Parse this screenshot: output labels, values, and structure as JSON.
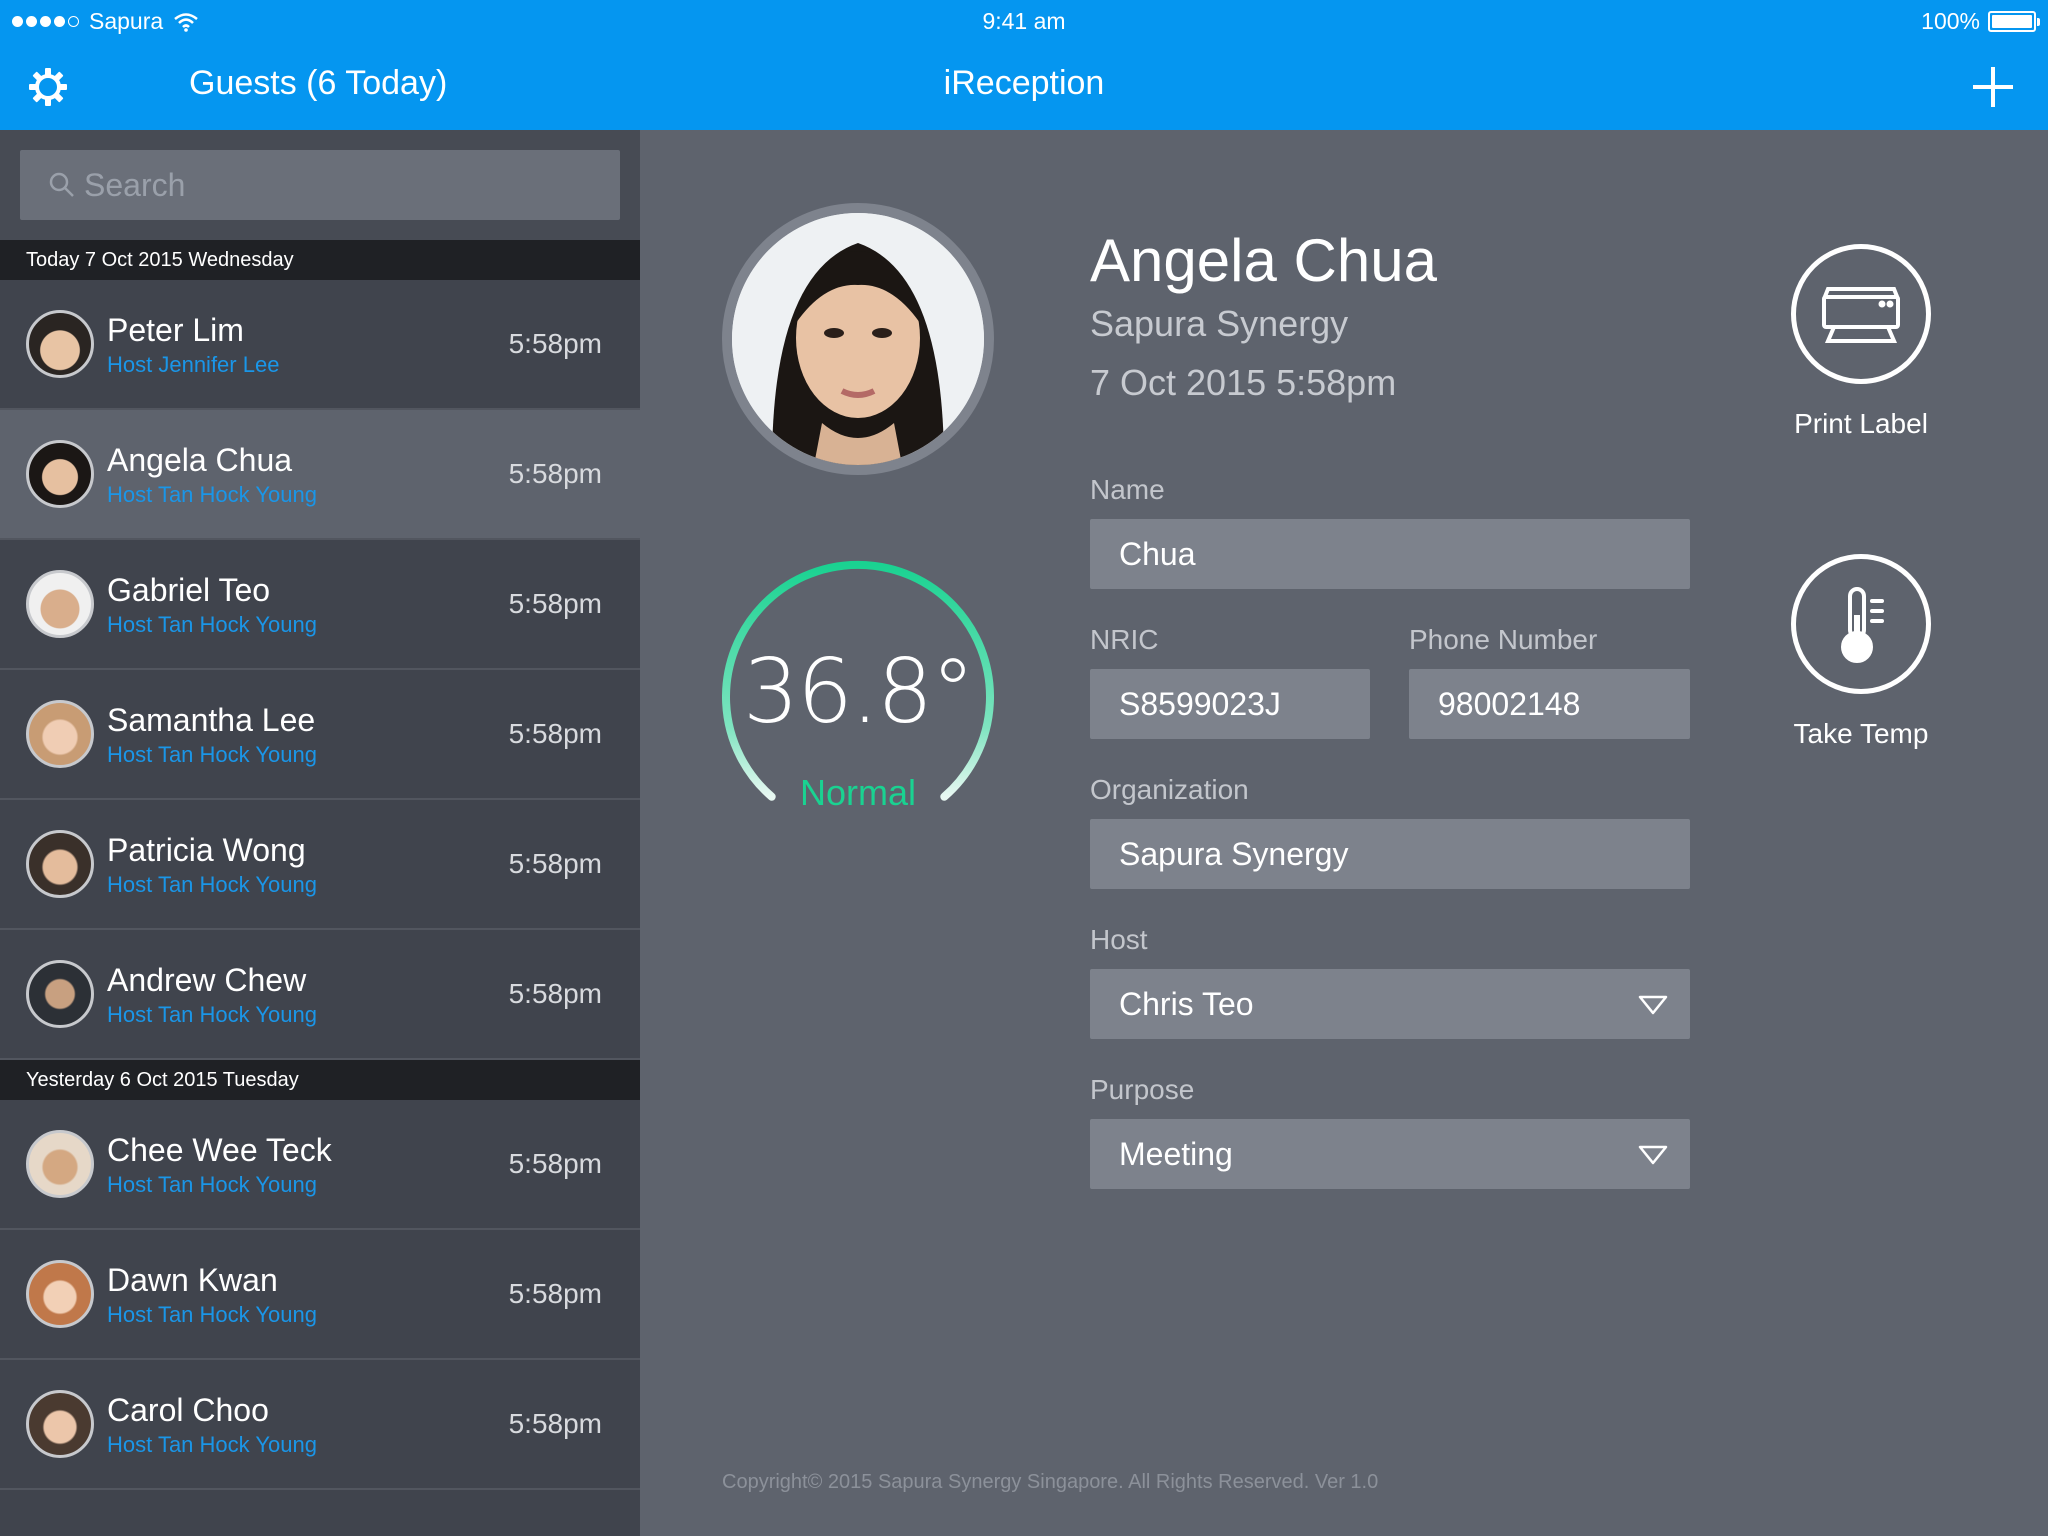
{
  "status_bar": {
    "carrier": "Sapura",
    "time": "9:41 am",
    "battery": "100%"
  },
  "nav": {
    "left_title": "Guests (6 Today)",
    "center_title": "iReception",
    "settings_icon": "gear-icon",
    "add_icon": "plus-icon"
  },
  "search": {
    "placeholder": "Search",
    "icon": "search-icon"
  },
  "sections": [
    {
      "header": "Today 7 Oct 2015 Wednesday",
      "guests": [
        {
          "name": "Peter Lim",
          "host": "Host Jennifer Lee",
          "time": "5:58pm"
        },
        {
          "name": "Angela Chua",
          "host": "Host Tan Hock Young",
          "time": "5:58pm",
          "selected": true
        },
        {
          "name": "Gabriel Teo",
          "host": "Host Tan Hock Young",
          "time": "5:58pm"
        },
        {
          "name": "Samantha Lee",
          "host": "Host Tan Hock Young",
          "time": "5:58pm"
        },
        {
          "name": "Patricia Wong",
          "host": "Host Tan Hock Young",
          "time": "5:58pm"
        },
        {
          "name": "Andrew Chew",
          "host": "Host Tan Hock Young",
          "time": "5:58pm"
        }
      ]
    },
    {
      "header": "Yesterday 6 Oct 2015 Tuesday",
      "guests": [
        {
          "name": "Chee Wee Teck",
          "host": "Host Tan Hock Young",
          "time": "5:58pm"
        },
        {
          "name": "Dawn Kwan",
          "host": "Host Tan Hock Young",
          "time": "5:58pm"
        },
        {
          "name": "Carol Choo",
          "host": "Host Tan Hock Young",
          "time": "5:58pm"
        }
      ]
    }
  ],
  "visitor": {
    "name": "Angela Chua",
    "organization": "Sapura Synergy",
    "datetime": "7 Oct 2015 5:58pm",
    "temperature": {
      "value": "36.8°",
      "status": "Normal",
      "status_color": "#1ad291"
    }
  },
  "form": {
    "name_label": "Name",
    "name_value": "Chua",
    "nric_label": "NRIC",
    "nric_value": "S8599023J",
    "phone_label": "Phone Number",
    "phone_value": "98002148",
    "org_label": "Organization",
    "org_value": "Sapura Synergy",
    "host_label": "Host",
    "host_value": "Chris Teo",
    "purpose_label": "Purpose",
    "purpose_value": "Meeting"
  },
  "actions": {
    "print_label": "Print Label",
    "print_icon": "printer-icon",
    "temp_label": "Take Temp",
    "temp_icon": "thermometer-icon"
  },
  "footer": "Copyright© 2015 Sapura Synergy Singapore. All Rights Reserved. Ver 1.0",
  "colors": {
    "accent": "#0596f0",
    "host_link": "#1a96e8",
    "background": "#5e636d",
    "sidebar": "#40444d"
  }
}
